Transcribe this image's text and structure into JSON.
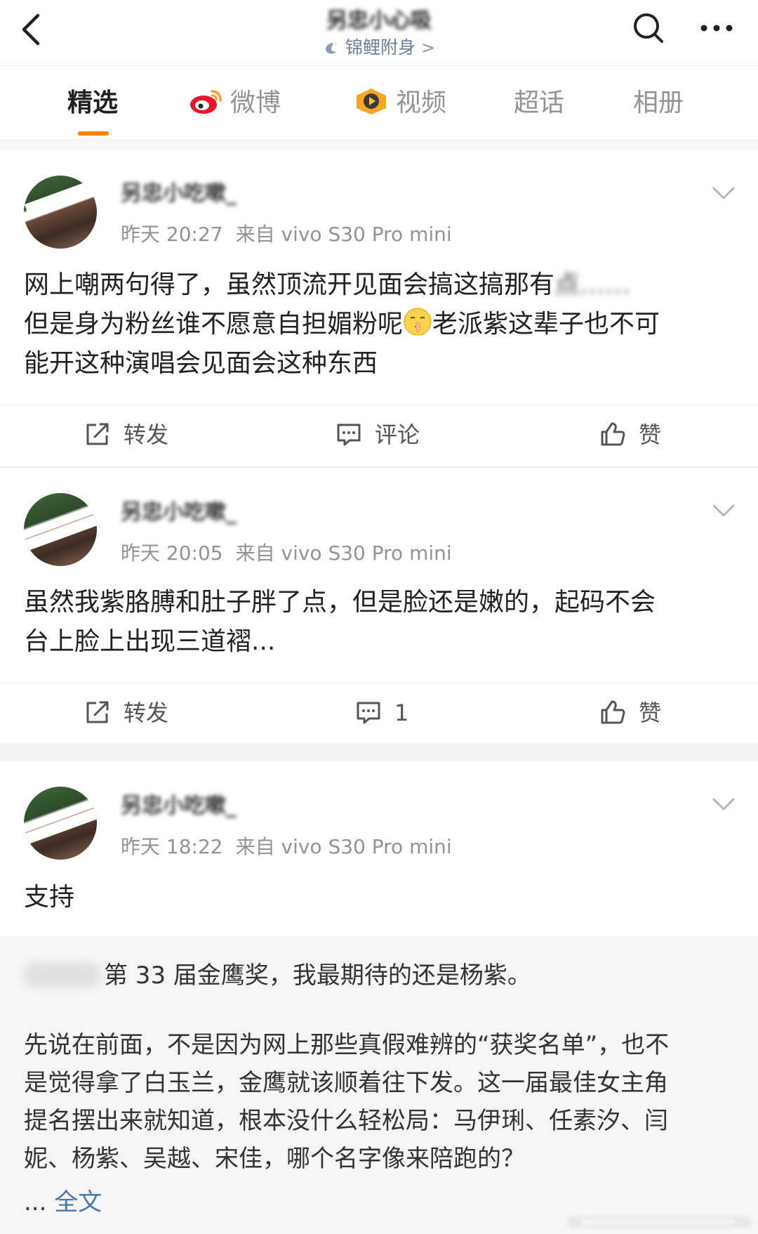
{
  "header": {
    "title": "另忠小心吸",
    "subtitle": "锦鲤附身",
    "subtitle_chevron": ">",
    "back_icon": "chevron-left-icon",
    "search_icon": "search-icon",
    "more_icon": "more-icon"
  },
  "tabs": [
    {
      "label": "精选",
      "active": true
    },
    {
      "label": "微博",
      "icon": "weibo-icon"
    },
    {
      "label": "视频",
      "icon": "video-icon"
    },
    {
      "label": "超话"
    },
    {
      "label": "相册"
    }
  ],
  "accent_color": "#ff8200",
  "posts": [
    {
      "username": "另忠小吃嗽_",
      "time": "昨天 20:27",
      "source": "来自 vivo S30 Pro mini",
      "text_lines": [
        "网上嘲两句得了，虽然顶流开见面会搞这搞那有",
        "但是身为粉丝谁不愿意自担媚粉呢",
        "老派紫这辈子也不可",
        "能开这种演唱会见面会这种东西"
      ],
      "blurred_fragment": "点……",
      "emoji": "shush-emoji-icon",
      "actions": {
        "repost": "转发",
        "comment": "评论",
        "like": "赞"
      }
    },
    {
      "username": "另忠小吃嗽_",
      "time": "昨天 20:05",
      "source": "来自 vivo S30 Pro mini",
      "text_lines": [
        "虽然我紫胳膊和肚子胖了点，但是脸还是嫩的，起码不会",
        "台上脸上出现三道褶..."
      ],
      "actions": {
        "repost": "转发",
        "comment": "1",
        "like": "赞"
      }
    },
    {
      "username": "另忠小吃嗽_",
      "time": "昨天 18:22",
      "source": "来自 vivo S30 Pro mini",
      "text_lines": [
        "支持"
      ]
    }
  ],
  "quote": {
    "headline": "第 33 届金鹰奖，我最期待的还是杨紫。",
    "body_lines": [
      "先说在前面，不是因为网上那些真假难辨的“获奖名单”，也不",
      "是觉得拿了白玉兰，金鹰就该顺着往下发。这一届最佳女主角",
      "提名摆出来就知道，根本没什么轻松局：马伊琍、任素汐、闫",
      "妮、杨紫、吴越、宋佳，哪个名字像来陪跑的？"
    ],
    "more_prefix": "...",
    "more_link": "全文"
  }
}
